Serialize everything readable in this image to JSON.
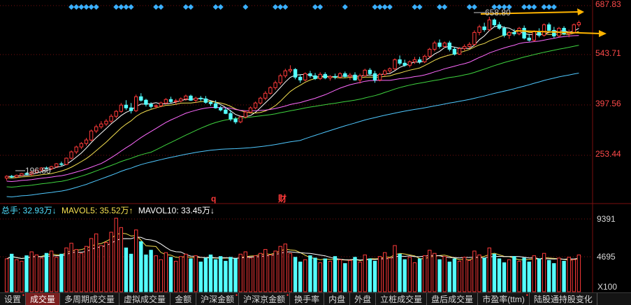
{
  "chart_data": {
    "type": "candlestick",
    "price_axis": {
      "ticks": [
        "687.83",
        "543.71",
        "397.56",
        "253.44"
      ],
      "range": [
        150,
        695
      ]
    },
    "annotations": {
      "high": "658.80",
      "low": "196.80",
      "markers": [
        "q",
        "财"
      ]
    },
    "ohlc": [
      [
        196.8,
        205,
        190,
        202
      ],
      [
        202,
        206,
        196,
        200
      ],
      [
        200,
        207,
        198,
        205
      ],
      [
        205,
        212,
        203,
        210
      ],
      [
        210,
        214,
        206,
        208
      ],
      [
        208,
        216,
        204,
        214
      ],
      [
        214,
        222,
        210,
        220
      ],
      [
        220,
        228,
        216,
        226
      ],
      [
        226,
        230,
        222,
        224
      ],
      [
        224,
        232,
        220,
        230
      ],
      [
        230,
        240,
        226,
        238
      ],
      [
        238,
        244,
        232,
        236
      ],
      [
        236,
        256,
        234,
        254
      ],
      [
        254,
        276,
        250,
        272
      ],
      [
        272,
        290,
        266,
        286
      ],
      [
        286,
        300,
        280,
        296
      ],
      [
        296,
        312,
        290,
        306
      ],
      [
        306,
        336,
        302,
        332
      ],
      [
        332,
        350,
        326,
        344
      ],
      [
        344,
        360,
        338,
        352
      ],
      [
        352,
        366,
        346,
        360
      ],
      [
        360,
        380,
        354,
        374
      ],
      [
        374,
        392,
        368,
        388
      ],
      [
        388,
        412,
        384,
        406
      ],
      [
        406,
        420,
        392,
        398
      ],
      [
        398,
        412,
        382,
        390
      ],
      [
        390,
        436,
        386,
        430
      ],
      [
        430,
        440,
        416,
        420
      ],
      [
        420,
        424,
        402,
        408
      ],
      [
        408,
        414,
        396,
        402
      ],
      [
        402,
        408,
        396,
        404
      ],
      [
        404,
        416,
        400,
        412
      ],
      [
        412,
        426,
        408,
        422
      ],
      [
        422,
        430,
        412,
        416
      ],
      [
        416,
        424,
        408,
        418
      ],
      [
        418,
        428,
        414,
        424
      ],
      [
        424,
        436,
        418,
        432
      ],
      [
        432,
        436,
        418,
        420
      ],
      [
        420,
        430,
        412,
        426
      ],
      [
        426,
        432,
        418,
        424
      ],
      [
        424,
        432,
        410,
        414
      ],
      [
        414,
        418,
        404,
        410
      ],
      [
        410,
        420,
        396,
        398
      ],
      [
        398,
        404,
        388,
        392
      ],
      [
        392,
        400,
        380,
        382
      ],
      [
        382,
        392,
        360,
        366
      ],
      [
        366,
        372,
        352,
        358
      ],
      [
        358,
        376,
        354,
        372
      ],
      [
        372,
        390,
        368,
        386
      ],
      [
        386,
        402,
        382,
        398
      ],
      [
        398,
        416,
        394,
        412
      ],
      [
        412,
        430,
        408,
        426
      ],
      [
        426,
        446,
        420,
        440
      ],
      [
        440,
        460,
        436,
        456
      ],
      [
        456,
        476,
        450,
        470
      ],
      [
        470,
        496,
        464,
        490
      ],
      [
        490,
        510,
        484,
        504
      ],
      [
        504,
        520,
        498,
        508
      ],
      [
        508,
        512,
        480,
        486
      ],
      [
        486,
        494,
        470,
        478
      ],
      [
        478,
        500,
        474,
        496
      ],
      [
        496,
        504,
        484,
        490
      ],
      [
        490,
        498,
        478,
        482
      ],
      [
        482,
        500,
        478,
        494
      ],
      [
        494,
        500,
        480,
        484
      ],
      [
        484,
        492,
        476,
        488
      ],
      [
        488,
        496,
        480,
        486
      ],
      [
        486,
        500,
        482,
        496
      ],
      [
        496,
        502,
        484,
        488
      ],
      [
        488,
        498,
        478,
        492
      ],
      [
        492,
        500,
        476,
        478
      ],
      [
        478,
        496,
        468,
        490
      ],
      [
        490,
        510,
        488,
        506
      ],
      [
        506,
        512,
        490,
        496
      ],
      [
        496,
        504,
        470,
        478
      ],
      [
        478,
        498,
        474,
        494
      ],
      [
        494,
        508,
        490,
        504
      ],
      [
        504,
        514,
        498,
        510
      ],
      [
        510,
        540,
        506,
        536
      ],
      [
        536,
        548,
        520,
        526
      ],
      [
        526,
        536,
        516,
        520
      ],
      [
        520,
        534,
        514,
        530
      ],
      [
        530,
        544,
        524,
        536
      ],
      [
        536,
        544,
        524,
        530
      ],
      [
        530,
        550,
        526,
        546
      ],
      [
        546,
        570,
        542,
        566
      ],
      [
        566,
        590,
        560,
        584
      ],
      [
        584,
        594,
        568,
        574
      ],
      [
        574,
        588,
        570,
        584
      ],
      [
        584,
        590,
        560,
        566
      ],
      [
        566,
        572,
        548,
        552
      ],
      [
        552,
        572,
        550,
        568
      ],
      [
        568,
        580,
        562,
        574
      ],
      [
        574,
        586,
        568,
        580
      ],
      [
        580,
        620,
        576,
        614
      ],
      [
        614,
        636,
        606,
        630
      ],
      [
        630,
        642,
        616,
        622
      ],
      [
        622,
        658.8,
        618,
        650
      ],
      [
        650,
        654,
        630,
        636
      ],
      [
        636,
        644,
        622,
        626
      ],
      [
        626,
        632,
        600,
        606
      ],
      [
        606,
        618,
        596,
        614
      ],
      [
        614,
        624,
        604,
        610
      ],
      [
        610,
        630,
        606,
        626
      ],
      [
        626,
        634,
        594,
        598
      ],
      [
        598,
        610,
        588,
        592
      ],
      [
        592,
        620,
        588,
        616
      ],
      [
        616,
        626,
        600,
        606
      ],
      [
        606,
        640,
        602,
        636
      ],
      [
        636,
        642,
        614,
        620
      ],
      [
        620,
        630,
        598,
        604
      ],
      [
        604,
        630,
        600,
        626
      ],
      [
        626,
        632,
        606,
        610
      ],
      [
        610,
        622,
        600,
        614
      ],
      [
        614,
        640,
        610,
        636
      ],
      [
        636,
        648,
        630,
        642
      ]
    ],
    "ma_lines": [
      {
        "name": "MA5",
        "color": "#ffffff"
      },
      {
        "name": "MA10",
        "color": "#f5e050"
      },
      {
        "name": "MA20",
        "color": "#ff6aff"
      },
      {
        "name": "MA30",
        "color": "#3fd43f"
      },
      {
        "name": "MA60",
        "color": "#4fc8ff"
      }
    ],
    "volume_axis": {
      "ticks": [
        "9391",
        "4695"
      ],
      "unit": "X100",
      "max": 9391
    },
    "volume": [
      4200,
      4800,
      4100,
      3900,
      4600,
      5100,
      4700,
      4300,
      4900,
      5200,
      4400,
      4800,
      5600,
      6200,
      5400,
      4900,
      5800,
      6800,
      7400,
      5900,
      6300,
      7600,
      9391,
      8200,
      5600,
      4800,
      7900,
      6400,
      4700,
      5300,
      4600,
      4100,
      5000,
      4400,
      3900,
      4500,
      4800,
      4200,
      4600,
      3800,
      4300,
      4700,
      4100,
      4500,
      3900,
      4400,
      4200,
      4800,
      5100,
      4300,
      4600,
      4900,
      5400,
      4700,
      5200,
      5800,
      6100,
      4900,
      4400,
      3800,
      4100,
      4600,
      4300,
      3700,
      4200,
      3900,
      4500,
      4100,
      3600,
      4000,
      4400,
      3800,
      4700,
      4200,
      3900,
      4500,
      5000,
      4300,
      5900,
      4800,
      4100,
      4400,
      3700,
      4200,
      4600,
      5300,
      4900,
      4100,
      4500,
      3800,
      4200,
      3900,
      4400,
      4000,
      5200,
      4700,
      4300,
      5600,
      4800,
      4200,
      3700,
      4100,
      4500,
      3900,
      4300,
      3800,
      4600,
      4200,
      4900,
      4000,
      3600,
      4300,
      3900,
      4400,
      4100,
      4700,
      4000
    ],
    "volume_legend": [
      {
        "label": "总手: 32.93万↓",
        "color": "#4fe0ff"
      },
      {
        "label": "MAVOL5: 35.52万↑",
        "color": "#f5e050"
      },
      {
        "label": "MAVOL10: 33.45万↓",
        "color": "#ffffff"
      }
    ],
    "colors": {
      "up": "#ff3a3a",
      "down": "#54ffff",
      "grid": "#7a1010",
      "diamond": "#3ab0ff",
      "arrow": "#ffb400"
    }
  },
  "tabs": [
    "设置",
    "成交量",
    "多周期成交量",
    "虚拟成交量",
    "金额",
    "沪深金额",
    "沪深京金额",
    "换手率",
    "内盘",
    "外盘",
    "立桩成交量",
    "盘后成交量",
    "市盈率(ttm)",
    "陆股通持股变化"
  ]
}
